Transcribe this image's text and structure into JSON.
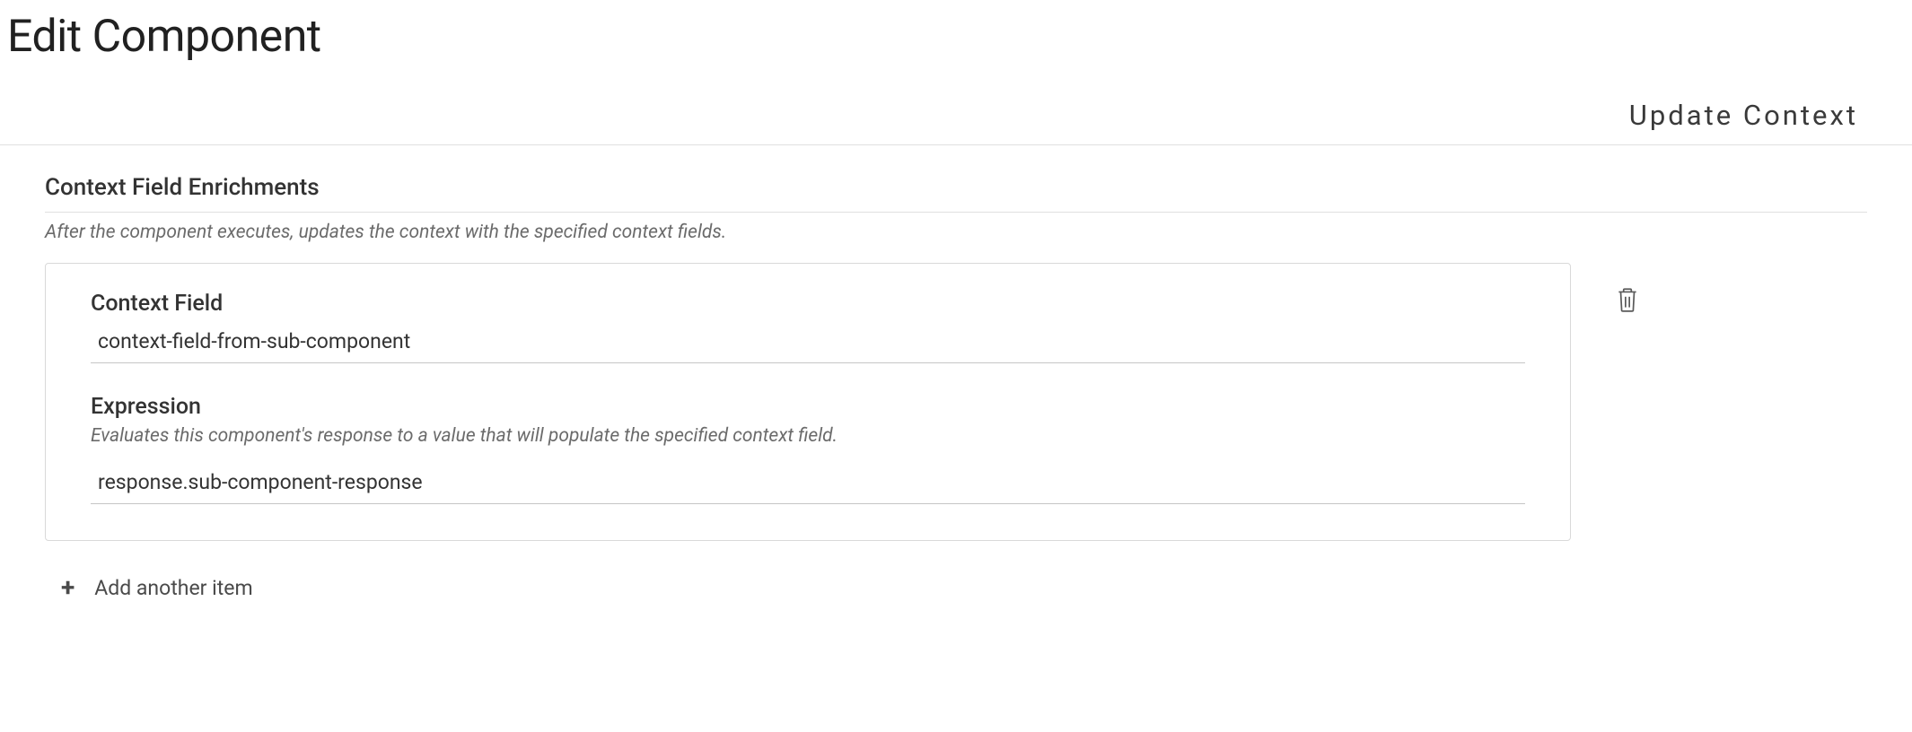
{
  "page": {
    "title": "Edit Component"
  },
  "section": {
    "tab_label": "Update Context"
  },
  "enrichments": {
    "title": "Context Field Enrichments",
    "description": "After the component executes, updates the context with the specified context fields.",
    "items": [
      {
        "context_field": {
          "label": "Context Field",
          "value": "context-field-from-sub-component"
        },
        "expression": {
          "label": "Expression",
          "help": "Evaluates this component's response to a value that will populate the specified context field.",
          "value": "response.sub-component-response"
        }
      }
    ],
    "add_label": "Add another item"
  }
}
